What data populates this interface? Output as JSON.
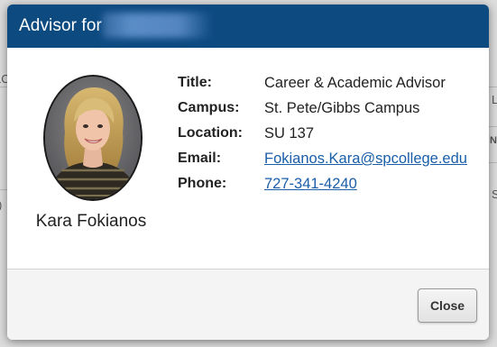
{
  "background_page": {
    "fragments": [
      "LC",
      "L",
      "N",
      "S",
      ")"
    ]
  },
  "modal": {
    "title": "Advisor for",
    "header_color": "#0d4a80",
    "advisor": {
      "name": "Kara Fokianos",
      "photo_alt": "advisor-photo"
    },
    "details": [
      {
        "label": "Title:",
        "value": "Career & Academic Advisor",
        "is_link": false
      },
      {
        "label": "Campus:",
        "value": "St. Pete/Gibbs Campus",
        "is_link": false
      },
      {
        "label": "Location:",
        "value": "SU 137",
        "is_link": false
      },
      {
        "label": "Email:",
        "value": "Fokianos.Kara@spcollege.edu",
        "is_link": true
      },
      {
        "label": "Phone:",
        "value": "727-341-4240",
        "is_link": true
      }
    ],
    "footer": {
      "close_label": "Close"
    }
  }
}
